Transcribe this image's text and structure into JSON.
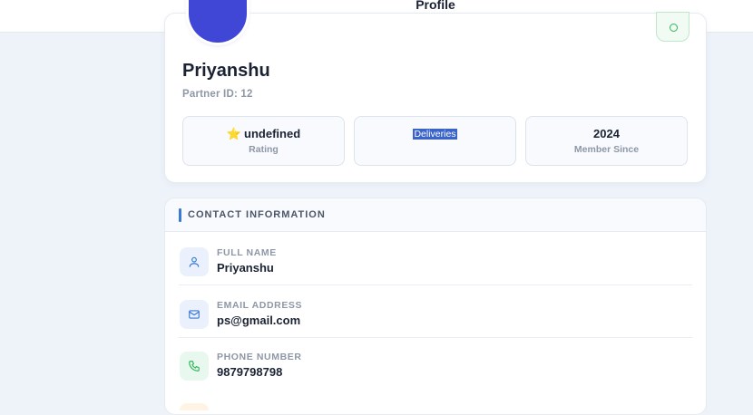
{
  "header": {
    "active_tab": "Profile"
  },
  "profile": {
    "name": "Priyanshu",
    "partner_id": "Partner ID: 12",
    "stats": [
      {
        "value": "undefined",
        "label": "Rating",
        "icon": "star-icon"
      },
      {
        "value": "Deliveries",
        "label": ""
      },
      {
        "value": "2024",
        "label": "Member Since"
      }
    ]
  },
  "contact": {
    "title": "CONTACT INFORMATION",
    "fields": [
      {
        "label": "FULL NAME",
        "value": "Priyanshu",
        "icon": "user-icon"
      },
      {
        "label": "EMAIL ADDRESS",
        "value": "ps@gmail.com",
        "icon": "mail-icon"
      },
      {
        "label": "PHONE NUMBER",
        "value": "9879798798",
        "icon": "phone-icon"
      }
    ]
  },
  "colors": {
    "accent": "#4a63e7",
    "avatar": "#4046d6",
    "verified": "#2fb65a",
    "section_bar": "#3a79d4"
  }
}
